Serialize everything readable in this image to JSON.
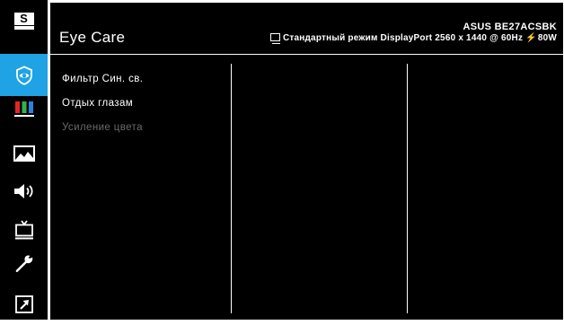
{
  "sidebar": {
    "items": [
      {
        "icon": "splendid-s-icon",
        "active": false
      },
      {
        "icon": "eye-care-icon",
        "active": true
      },
      {
        "icon": "color-bars-icon",
        "active": false
      },
      {
        "icon": "image-icon",
        "active": false
      },
      {
        "icon": "speaker-icon",
        "active": false
      },
      {
        "icon": "input-select-icon",
        "active": false
      },
      {
        "icon": "wrench-icon",
        "active": false
      },
      {
        "icon": "shortcut-arrow-icon",
        "active": false
      }
    ],
    "s_label": "S",
    "active_color": "#1fa3e4"
  },
  "header": {
    "title": "Eye Care",
    "model": "ASUS BE27ACSBK",
    "status": "Стандартный режим DisplayPort 2560 x 1440 @ 60Hz",
    "power": "80W"
  },
  "menu": {
    "items": [
      {
        "label": "Фильтр Син. св.",
        "enabled": true
      },
      {
        "label": "Отдых глазам",
        "enabled": true
      },
      {
        "label": "Усиление цвета",
        "enabled": false
      }
    ]
  }
}
